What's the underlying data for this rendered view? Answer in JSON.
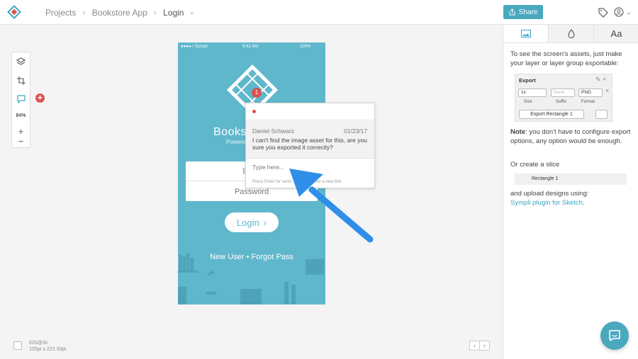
{
  "breadcrumb": {
    "projects": "Projects",
    "app": "Bookstore App",
    "screen": "Login"
  },
  "topbar": {
    "share_label": "Share"
  },
  "tools": {
    "zoom": "84%",
    "plus": "+",
    "minus": "−"
  },
  "phone": {
    "status_left": "●●●●○ Sympli",
    "status_time": "9:41 AM",
    "status_battery": "100%",
    "brand": "Books",
    "powered": "Powere",
    "email_placeholder": "E",
    "password_placeholder": "Password",
    "login_label": "Login",
    "links": "New User • Forgot Pass"
  },
  "comment": {
    "pin_count": "1",
    "author": "Daniel Schwarz",
    "date": "01/23/17",
    "message": "I can't find the image asset for this, are you sure you exported it correctly?",
    "input_placeholder": "Type here...",
    "hint": "Press Enter for send, Shift+Enter for a new line"
  },
  "bottom": {
    "device": "iOS@3x",
    "size": "125pt x 222.33pt",
    "prev": "‹",
    "next": "›"
  },
  "panel": {
    "tab_text": "Aa",
    "intro": "To see the screen's assets, just make your layer or layer group exportable:",
    "export_title": "Export",
    "export_size_value": "1x",
    "export_suffix_placeholder": "None",
    "export_format_value": "PNG",
    "cap_size": "Size",
    "cap_suffix": "Suffix",
    "cap_format": "Format",
    "export_button": "Export Rectangle 1",
    "note_label": "Note",
    "note_text": ": you don't have to configure export options, any option would be enough.",
    "slice_text": "Or create a slice",
    "slice_item": "Rectangle 1",
    "upload_text": "and upload designs using:",
    "plugin_link": "Sympli plugin for Sketch",
    "period": "."
  },
  "colors": {
    "accent": "#4aa8bf",
    "phone_bg": "#5fb7cc",
    "alert": "#d9534f",
    "arrow": "#2f8fe8"
  }
}
